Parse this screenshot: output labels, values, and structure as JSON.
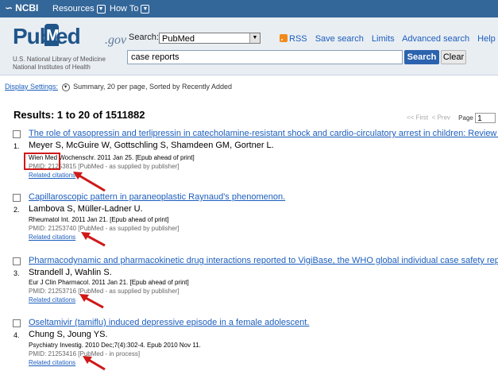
{
  "topbar": {
    "brand": "NCBI",
    "menu": [
      {
        "label": "Resources"
      },
      {
        "label": "How To"
      }
    ]
  },
  "logo": {
    "pub": "Pub",
    "m": "M",
    "med": "ed",
    "gov": ".gov",
    "line1": "U.S. National Library of Medicine",
    "line2": "National Institutes of Health"
  },
  "search": {
    "label": "Search:",
    "database": "PubMed",
    "query": "case reports",
    "search_button": "Search",
    "clear_button": "Clear",
    "links": [
      "RSS",
      "Save search",
      "Limits",
      "Advanced search",
      "Help"
    ]
  },
  "display": {
    "link": "Display Settings:",
    "summary": "Summary, 20 per page, Sorted by Recently Added"
  },
  "results": {
    "title": "Results: 1 to 20 of 1511882",
    "pager": {
      "first": "<< First",
      "prev": "< Prev",
      "page_label": "Page",
      "page_value": "1"
    },
    "items": [
      {
        "num": "1.",
        "title": "The role of vasopressin and terlipressin in catecholamine-resistant shock and cardio-circulatory arrest in children: Review o",
        "authors": "Meyer S, McGuire W, Gottschling S, Shamdeen GM, Gortner L.",
        "journal": "Wien Med Wochenschr. 2011 Jan 25. [Epub ahead of print]",
        "pmid": "PMID: 21253815 [PubMed - as supplied by publisher]",
        "related": "Related citations"
      },
      {
        "num": "2.",
        "title": "Capillaroscopic pattern in paraneoplastic Raynaud's phenomenon.",
        "authors": "Lambova S, Müller-Ladner U.",
        "journal": "Rheumatol Int. 2011 Jan 21. [Epub ahead of print]",
        "pmid": "PMID: 21253740 [PubMed - as supplied by publisher]",
        "related": "Related citations"
      },
      {
        "num": "3.",
        "title": "Pharmacodynamic and pharmacokinetic drug interactions reported to VigiBase, the WHO global individual case safety repor",
        "authors": "Strandell J, Wahlin S.",
        "journal": "Eur J Clin Pharmacol. 2011 Jan 21. [Epub ahead of print]",
        "pmid": "PMID: 21253716 [PubMed - as supplied by publisher]",
        "related": "Related citations"
      },
      {
        "num": "4.",
        "title": "Oseltamivir (tamiflu) induced depressive episode in a female adolescent.",
        "authors": "Chung S, Joung YS.",
        "journal": "Psychiatry Investig. 2010 Dec;7(4):302-4. Epub 2010 Nov 11.",
        "pmid": "PMID: 21253416 [PubMed - in process]",
        "related": "Related citations"
      }
    ]
  },
  "colors": {
    "topbar": "#336699",
    "link": "#1c5ebd",
    "annotation": "#d01818",
    "search_button": "#2b63ae"
  }
}
